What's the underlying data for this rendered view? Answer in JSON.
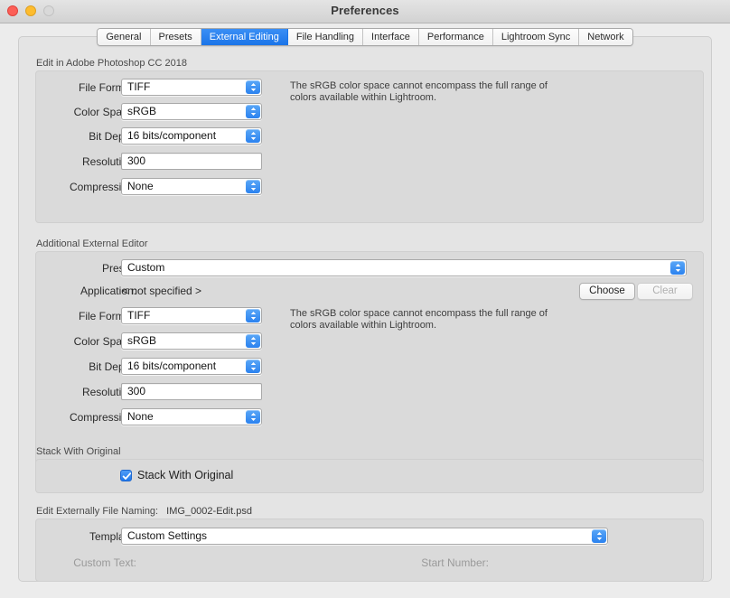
{
  "window": {
    "title": "Preferences",
    "traffic": {
      "close": "close-button",
      "minimize": "minimize-button",
      "zoom": "zoom-button"
    }
  },
  "tabs": [
    {
      "label": "General",
      "active": false
    },
    {
      "label": "Presets",
      "active": false
    },
    {
      "label": "External Editing",
      "active": true
    },
    {
      "label": "File Handling",
      "active": false
    },
    {
      "label": "Interface",
      "active": false
    },
    {
      "label": "Performance",
      "active": false
    },
    {
      "label": "Lightroom Sync",
      "active": false
    },
    {
      "label": "Network",
      "active": false
    }
  ],
  "photoshop_section": {
    "title": "Edit in Adobe Photoshop CC 2018",
    "help_text": "The sRGB color space cannot encompass the full range of colors available within Lightroom.",
    "fields": {
      "file_format_label": "File Format:",
      "file_format_value": "TIFF",
      "color_space_label": "Color Space:",
      "color_space_value": "sRGB",
      "bit_depth_label": "Bit Depth:",
      "bit_depth_value": "16 bits/component",
      "resolution_label": "Resolution:",
      "resolution_value": "300",
      "compression_label": "Compression:",
      "compression_value": "None"
    }
  },
  "additional_editor_section": {
    "title": "Additional External Editor",
    "help_text": "The sRGB color space cannot encompass the full range of colors available within Lightroom.",
    "fields": {
      "preset_label": "Preset:",
      "preset_value": "Custom",
      "application_label": "Application:",
      "application_value": "< not specified >",
      "file_format_label": "File Format:",
      "file_format_value": "TIFF",
      "color_space_label": "Color Space:",
      "color_space_value": "sRGB",
      "bit_depth_label": "Bit Depth:",
      "bit_depth_value": "16 bits/component",
      "resolution_label": "Resolution:",
      "resolution_value": "300",
      "compression_label": "Compression:",
      "compression_value": "None"
    },
    "buttons": {
      "choose": "Choose",
      "clear": "Clear"
    }
  },
  "stack_section": {
    "title": "Stack With Original",
    "checkbox_label": "Stack With Original",
    "checked": true
  },
  "naming_section": {
    "title": "Edit Externally File Naming:",
    "example_filename": "IMG_0002-Edit.psd",
    "template_label": "Template:",
    "template_value": "Custom Settings",
    "custom_text_label": "Custom Text:",
    "start_number_label": "Start Number:"
  },
  "colors": {
    "accent": "#2b82ef",
    "window_bg": "#ececec",
    "panel_bg": "#dadada"
  }
}
